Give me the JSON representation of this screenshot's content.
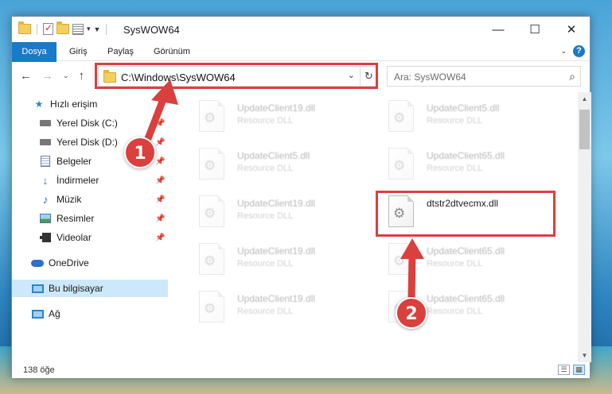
{
  "window": {
    "title": "SysWOW64",
    "controls": {
      "minimize": "—",
      "maximize": "☐",
      "close": "✕"
    }
  },
  "ribbon": {
    "tabs": [
      "Dosya",
      "Giriş",
      "Paylaş",
      "Görünüm"
    ]
  },
  "address": {
    "path": "C:\\Windows\\SysWOW64",
    "search_placeholder": "Ara: SysWOW64"
  },
  "sidebar": {
    "items": [
      {
        "label": "Hızlı erişim",
        "icon": "star-icon"
      },
      {
        "label": "Yerel Disk (C:)",
        "icon": "drive-icon",
        "pinned": true
      },
      {
        "label": "Yerel Disk (D:)",
        "icon": "drive-icon",
        "pinned": true
      },
      {
        "label": "Belgeler",
        "icon": "documents-icon",
        "pinned": true
      },
      {
        "label": "İndirmeler",
        "icon": "download-icon",
        "pinned": true
      },
      {
        "label": "Müzik",
        "icon": "music-icon",
        "pinned": true
      },
      {
        "label": "Resimler",
        "icon": "pictures-icon",
        "pinned": true
      },
      {
        "label": "Videolar",
        "icon": "videos-icon",
        "pinned": true
      },
      {
        "label": "OneDrive",
        "icon": "cloud-icon"
      },
      {
        "label": "Bu bilgisayar",
        "icon": "computer-icon",
        "selected": true
      },
      {
        "label": "Ağ",
        "icon": "network-icon"
      }
    ]
  },
  "files": {
    "col1": [
      {
        "name": "UpdateClient19.dll",
        "type": "Resource DLL"
      },
      {
        "name": "UpdateClient5.dll",
        "type": "Resource DLL"
      },
      {
        "name": "UpdateClient19.dll",
        "type": "Resource DLL"
      },
      {
        "name": "UpdateClient19.dll",
        "type": "Resource DLL"
      },
      {
        "name": "UpdateClient19.dll",
        "type": "Resource DLL"
      }
    ],
    "col2": [
      {
        "name": "UpdateClient5.dll",
        "type": "Resource DLL"
      },
      {
        "name": "UpdateClient65.dll",
        "type": "Resource DLL"
      },
      {
        "name": "dtstr2dtvecmx.dll",
        "type": ""
      },
      {
        "name": "UpdateClient65.dll",
        "type": "Resource DLL"
      },
      {
        "name": "UpdateClient65.dll",
        "type": "Resource DLL"
      }
    ]
  },
  "status": {
    "count": "138 öğe"
  },
  "annotations": {
    "step1": "1",
    "step2": "2",
    "color": "#d9403e"
  }
}
